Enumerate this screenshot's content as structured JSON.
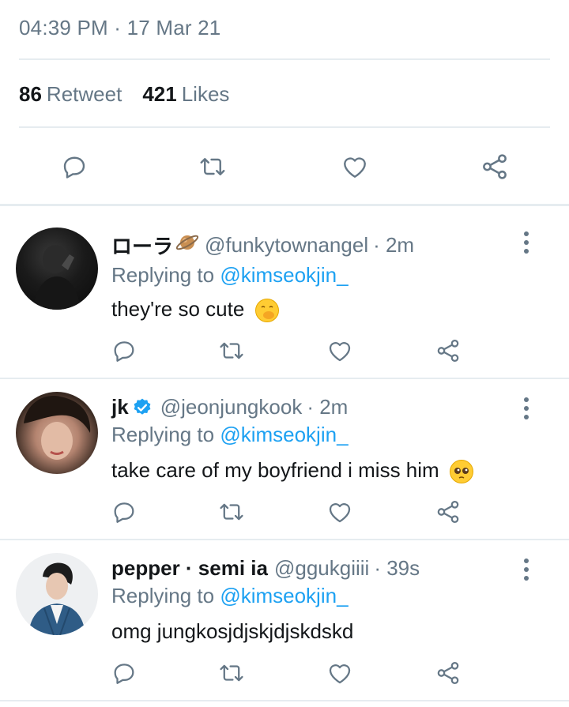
{
  "tweet": {
    "timestamp": "04:39 PM · 17 Mar 21",
    "retweet_count": "86",
    "retweet_label": "Retweet",
    "likes_count": "421",
    "likes_label": "Likes"
  },
  "actions": {
    "icons": [
      "comment-icon",
      "retweet-icon",
      "like-icon",
      "share-icon"
    ]
  },
  "replies": [
    {
      "display_name": "ローラ",
      "name_emoji": "planet-icon",
      "handle": "@funkytownangel",
      "time": "· 2m",
      "replying_prefix": "Replying to",
      "replying_to": "@kimseokjin_",
      "text": "they're so cute",
      "emoji": "hand-over-mouth-emoji"
    },
    {
      "display_name": "jk",
      "verified": true,
      "handle": "@jeonjungkook",
      "time": "· 2m",
      "replying_prefix": "Replying to",
      "replying_to": "@kimseokjin_",
      "text": "take care of my boyfriend i miss him",
      "emoji": "pleading-face-emoji"
    },
    {
      "display_name": "pepper · semi ia",
      "handle": "@ggukgiiii",
      "time": "· 39s",
      "replying_prefix": "Replying to",
      "replying_to": "@kimseokjin_",
      "text": "omg jungkosjdjskjdjskdskd"
    }
  ],
  "colors": {
    "accent": "#1da1f2",
    "secondary_text": "#657786",
    "icon": "#657786",
    "divider": "#e6ecf0"
  }
}
